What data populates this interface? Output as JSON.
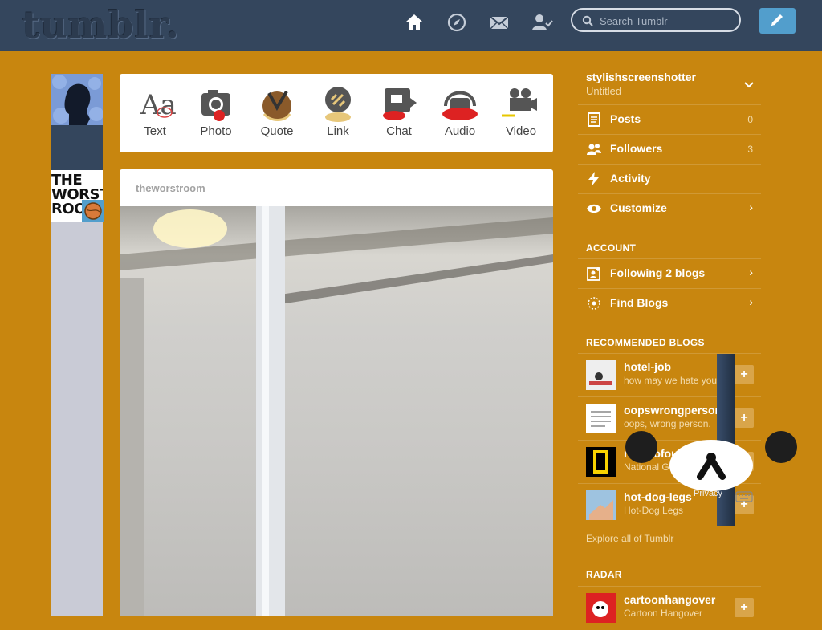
{
  "header": {
    "logo": "tumblr.",
    "search_placeholder": "Search Tumblr",
    "nav": [
      "home-icon",
      "explore-icon",
      "mail-icon",
      "account-icon"
    ],
    "compose": "pencil-icon"
  },
  "post_types": [
    {
      "label": "Text"
    },
    {
      "label": "Photo"
    },
    {
      "label": "Quote"
    },
    {
      "label": "Link"
    },
    {
      "label": "Chat"
    },
    {
      "label": "Audio"
    },
    {
      "label": "Video"
    }
  ],
  "avatar2_text": "THE WORST ROO",
  "post": {
    "author": "theworstroom"
  },
  "sidebar": {
    "blog_name": "stylishscreenshotter",
    "blog_sub": "Untitled",
    "items": [
      {
        "label": "Posts",
        "count": "0"
      },
      {
        "label": "Followers",
        "count": "3"
      },
      {
        "label": "Activity"
      },
      {
        "label": "Customize"
      }
    ],
    "account_head": "ACCOUNT",
    "account_items": [
      {
        "label": "Following 2 blogs"
      },
      {
        "label": "Find Blogs"
      }
    ],
    "recommended_head": "RECOMMENDED BLOGS",
    "recommended": [
      {
        "name": "hotel-job",
        "desc": "how may we hate you?"
      },
      {
        "name": "oopswrongpersons",
        "desc": "oops, wrong person."
      },
      {
        "name": "natgeofound",
        "desc": "National Geographic Fo..."
      },
      {
        "name": "hot-dog-legs",
        "desc": "Hot-Dog Legs"
      }
    ],
    "privacy_text": "Privacy",
    "explore": "Explore all of Tumblr",
    "radar_head": "RADAR",
    "radar": {
      "name": "cartoonhangover",
      "desc": "Cartoon Hangover"
    }
  },
  "colors": {
    "background": "#C8860F",
    "topbar": "#34465D",
    "compose": "#529ECC"
  }
}
